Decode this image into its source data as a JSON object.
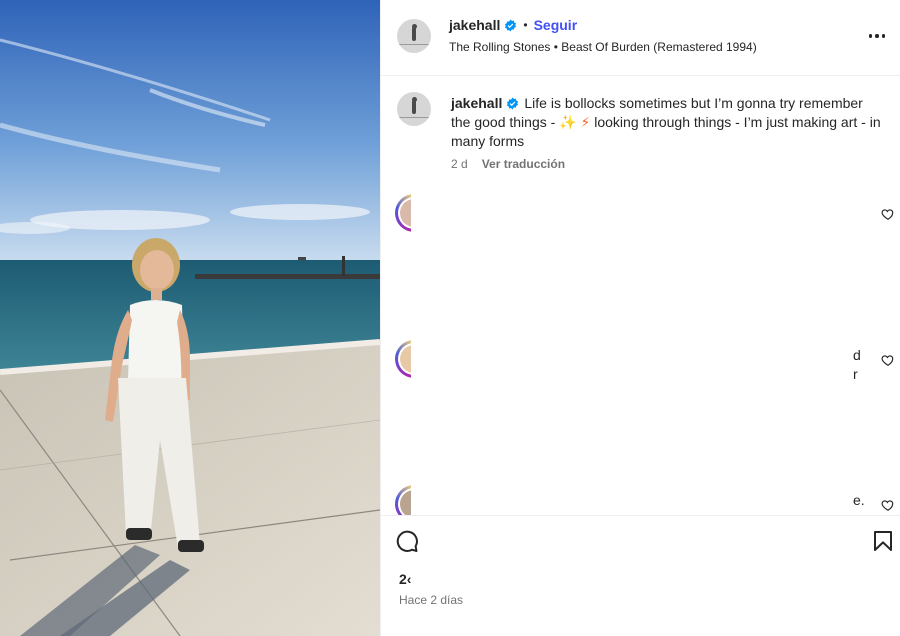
{
  "header": {
    "username": "jakehall",
    "follow_label": "Seguir",
    "separator": "•",
    "audio": "The Rolling Stones • Beast Of Burden (Remastered 1994)"
  },
  "caption": {
    "username": "jakehall",
    "text_part1": "Life is bollocks sometimes but I’m gonna try remember the good things - ",
    "emoji_sparkles": "✨",
    "emoji_bolt": "⚡",
    "text_part2": " looking through things - I’m just making art - in many forms",
    "age": "2 d",
    "translate_label": "Ver traducción"
  },
  "comments": [
    {
      "fragment_a": "",
      "fragment_b": ""
    },
    {
      "fragment_a": "d",
      "fragment_b": "r"
    },
    {
      "fragment_a": "e.",
      "fragment_b": ""
    }
  ],
  "footer": {
    "likes_fragment": "2‹",
    "time_ago": "Hace 2 días"
  },
  "colors": {
    "accent_follow": "#4150f7",
    "verified": "#0095f6",
    "muted_text": "#737373"
  },
  "icons": [
    "verified-badge-icon",
    "more-options-icon",
    "heart-icon",
    "comment-icon",
    "bookmark-icon"
  ]
}
